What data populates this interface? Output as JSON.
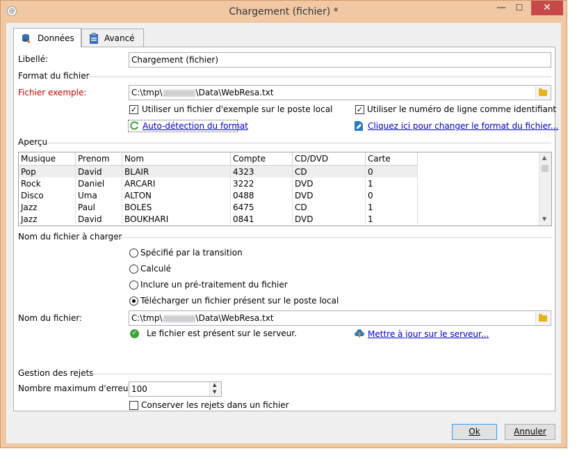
{
  "window": {
    "title": "Chargement (fichier) *",
    "app_icon_glyph": "@",
    "minimize": "—",
    "maximize": "☐",
    "close": "✕"
  },
  "tabs": [
    {
      "label": "Données",
      "icon": "database-icon"
    },
    {
      "label": "Avancé",
      "icon": "clipboard-icon"
    }
  ],
  "libelle": {
    "label": "Libellé:",
    "value": "Chargement (fichier)"
  },
  "format": {
    "section": "Format du fichier",
    "sample_label": "Fichier exemple:",
    "sample_path_prefix": "C:\\tmp\\",
    "sample_path_suffix": "\\Data\\WebResa.txt",
    "use_local": "Utiliser un fichier d'exemple sur le poste local",
    "use_line_number": "Utiliser le numéro de ligne comme identifiant",
    "auto_detect": "Auto-détection du format",
    "change_format": "Cliquez ici pour changer le format du fichier..."
  },
  "preview": {
    "section": "Aperçu",
    "columns": [
      "Musique",
      "Prenom",
      "Nom",
      "Compte",
      "CD/DVD",
      "Carte"
    ],
    "rows": [
      [
        "Pop",
        "David",
        "BLAIR",
        "4323",
        "CD",
        "0"
      ],
      [
        "Rock",
        "Daniel",
        "ARCARI",
        "3222",
        "DVD",
        "1"
      ],
      [
        "Disco",
        "Uma",
        "ALTON",
        "0488",
        "DVD",
        "0"
      ],
      [
        "Jazz",
        "Paul",
        "BOLES",
        "6475",
        "CD",
        "1"
      ],
      [
        "Jazz",
        "David",
        "BOUKHARI",
        "0841",
        "DVD",
        "1"
      ]
    ]
  },
  "load": {
    "section": "Nom du fichier à charger",
    "options": [
      "Spécifié par la transition",
      "Calculé",
      "Inclure un pré-traitement du fichier",
      "Télécharger un fichier présent sur le poste local"
    ],
    "file_label": "Nom du fichier:",
    "file_path_prefix": "C:\\tmp\\",
    "file_path_suffix": "\\Data\\WebResa.txt",
    "status": "Le fichier est présent sur le serveur.",
    "update_link": "Mettre à jour sur le serveur..."
  },
  "rejects": {
    "section": "Gestion des rejets",
    "max_errors_label": "Nombre maximum d'erreurs:",
    "max_errors_value": "100",
    "keep_rejects": "Conserver les rejets dans un fichier"
  },
  "buttons": {
    "ok": "Ok",
    "cancel": "Annuler"
  }
}
